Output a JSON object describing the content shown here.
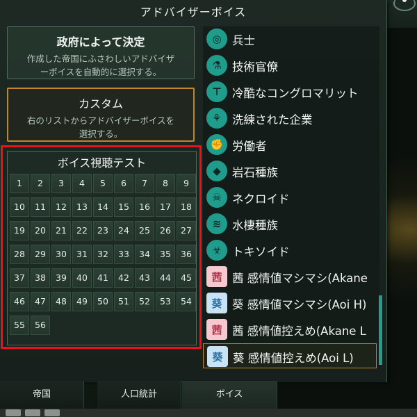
{
  "panel": {
    "title": "アドバイザーボイス"
  },
  "gov_option": {
    "title": "政府によって決定",
    "desc_line1": "作成した帝国にふさわしいアドバイザ",
    "desc_line2": "ーボイスを自動的に選択する。"
  },
  "custom_option": {
    "title": "カスタム",
    "desc_line1": "右のリストからアドバイザーボイスを",
    "desc_line2": "選択する。"
  },
  "voice_test": {
    "title": "ボイス視聴テスト",
    "buttons": [
      "1",
      "2",
      "3",
      "4",
      "5",
      "6",
      "7",
      "8",
      "9",
      "10",
      "11",
      "12",
      "13",
      "14",
      "15",
      "16",
      "17",
      "18",
      "19",
      "20",
      "21",
      "22",
      "23",
      "24",
      "25",
      "26",
      "27",
      "28",
      "29",
      "30",
      "31",
      "32",
      "33",
      "34",
      "35",
      "36",
      "37",
      "38",
      "39",
      "40",
      "41",
      "42",
      "43",
      "44",
      "45",
      "46",
      "47",
      "48",
      "49",
      "50",
      "51",
      "52",
      "53",
      "54",
      "55",
      "56"
    ]
  },
  "voice_list": {
    "items": [
      {
        "label": "兵士",
        "icon": "soldier-icon",
        "glyph": "◎"
      },
      {
        "label": "技術官僚",
        "icon": "microscope-icon",
        "glyph": "⚗"
      },
      {
        "label": "冷酷なコングロマリット",
        "icon": "conglomerate-icon",
        "glyph": "⊤"
      },
      {
        "label": "洗練された企業",
        "icon": "corporate-icon",
        "glyph": "⚘"
      },
      {
        "label": "労働者",
        "icon": "worker-icon",
        "glyph": "✊"
      },
      {
        "label": "岩石種族",
        "icon": "lithoid-icon",
        "glyph": "◆"
      },
      {
        "label": "ネクロイド",
        "icon": "necroid-icon",
        "glyph": "☠"
      },
      {
        "label": "水棲種族",
        "icon": "aquatic-icon",
        "glyph": "≋"
      },
      {
        "label": "トキソイド",
        "icon": "toxoid-icon",
        "glyph": "☣"
      },
      {
        "label": "茜 感情値マシマシ(Akane",
        "icon": "akane-avatar-icon",
        "glyph": "茜"
      },
      {
        "label": "葵 感情値マシマシ(Aoi H)",
        "icon": "aoi-avatar-icon",
        "glyph": "葵"
      },
      {
        "label": "茜 感情値控えめ(Akane L",
        "icon": "akane-avatar-icon",
        "glyph": "茜"
      },
      {
        "label": "葵 感情値控えめ(Aoi L)",
        "icon": "aoi-avatar-icon",
        "glyph": "葵"
      }
    ],
    "selected_index": 12
  },
  "tabs": [
    {
      "label": "帝国"
    },
    {
      "label": "人口統計"
    },
    {
      "label": "ボイス"
    }
  ],
  "colors": {
    "accent_orange": "#c4862d",
    "highlight_red": "#e8141a",
    "icon_teal": "#1f9c8c"
  }
}
